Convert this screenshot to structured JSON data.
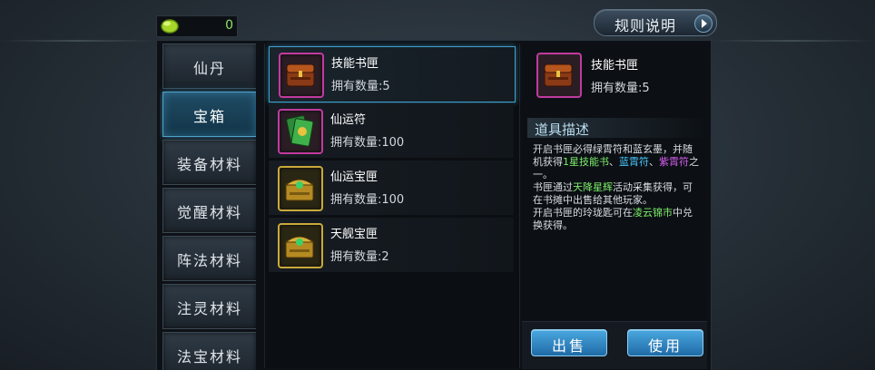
{
  "currency": {
    "value": "0",
    "icon": "green-gem-icon"
  },
  "rules_button": {
    "label": "规则说明"
  },
  "sidebar": {
    "tabs": [
      {
        "label": "仙丹",
        "active": false
      },
      {
        "label": "宝箱",
        "active": true
      },
      {
        "label": "装备材料",
        "active": false
      },
      {
        "label": "觉醒材料",
        "active": false
      },
      {
        "label": "阵法材料",
        "active": false
      },
      {
        "label": "注灵材料",
        "active": false
      },
      {
        "label": "法宝材料",
        "active": false
      }
    ]
  },
  "items": [
    {
      "name": "技能书匣",
      "qty": "拥有数量:5",
      "icon": "book-chest-icon",
      "selected": true
    },
    {
      "name": "仙运符",
      "qty": "拥有数量:100",
      "icon": "talisman-icon",
      "selected": false
    },
    {
      "name": "仙运宝匣",
      "qty": "拥有数量:100",
      "icon": "gold-chest-icon",
      "selected": false
    },
    {
      "name": "天舰宝匣",
      "qty": "拥有数量:2",
      "icon": "gold-chest-icon",
      "selected": false
    }
  ],
  "detail": {
    "name": "技能书匣",
    "qty": "拥有数量:5",
    "desc_title": "道具描述",
    "desc": {
      "p1": "开启书匣必得绿霄符和蓝玄墨，并随机获得",
      "h1": "1星技能书",
      "p2": "、",
      "h2": "蓝霄符",
      "p3": "、",
      "h3": "紫霄符",
      "p4": "之一。",
      "p5": "书匣通过",
      "h4": "天降星辉",
      "p6": "活动采集获得，可在书摊中出售给其他玩家。",
      "p7": "开启书匣的玲珑匙可在",
      "h5": "凌云锦市",
      "p8": "中兑换获得。"
    },
    "sell_label": "出售",
    "use_label": "使用"
  },
  "colors": {
    "accent_blue": "#4ba8e0",
    "highlight_green": "#7ef06a",
    "highlight_blue": "#49c8ff",
    "highlight_purple": "#d55cf0",
    "currency_green": "#8fe26a",
    "rare_frame": "#c23aa0",
    "gold_frame": "#c9a93a"
  }
}
